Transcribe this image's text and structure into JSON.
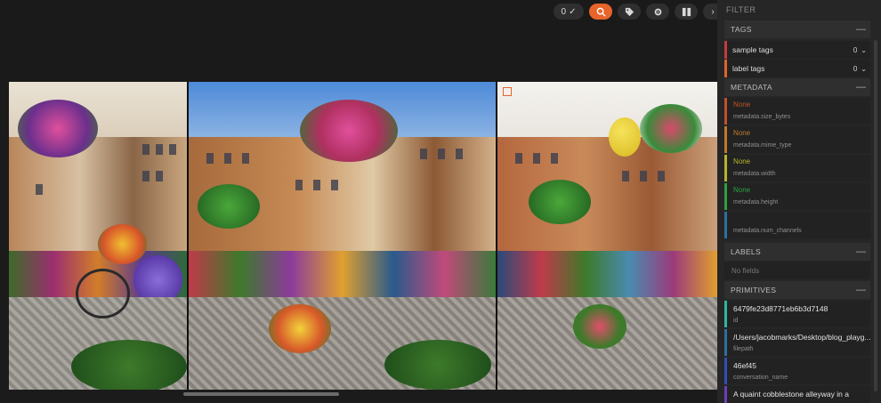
{
  "toolbar": {
    "selection_count": "0",
    "buttons": [
      "selection-check",
      "search",
      "tag",
      "settings",
      "layout",
      "next"
    ]
  },
  "sidebar": {
    "filter_title": "FILTER",
    "tags": {
      "title": "TAGS",
      "items": [
        {
          "label": "sample tags",
          "count": "0",
          "color": "#c33b3b"
        },
        {
          "label": "label tags",
          "count": "0",
          "color": "#e0642a"
        }
      ]
    },
    "metadata": {
      "title": "METADATA",
      "items": [
        {
          "value": "None",
          "key": "metadata.size_bytes",
          "color": "#c0522a"
        },
        {
          "value": "None",
          "key": "metadata.mime_type",
          "color": "#c07a2a"
        },
        {
          "value": "None",
          "key": "metadata.width",
          "color": "#b7b52a"
        },
        {
          "value": "None",
          "key": "metadata.height",
          "color": "#2ea043"
        },
        {
          "value": "",
          "key": "metadata.num_channels",
          "color": "#2e6fa0"
        }
      ]
    },
    "labels": {
      "title": "LABELS",
      "empty_text": "No fields"
    },
    "primitives": {
      "title": "PRIMITIVES",
      "items": [
        {
          "value": "6479fe23d8771eb6b3d7148",
          "key": "id",
          "color": "#2fb6a0"
        },
        {
          "value": "/Users/jacobmarks/Desktop/blog_playg...",
          "key": "filepath",
          "color": "#2e6fa0"
        },
        {
          "value": "46ef45",
          "key": "conversation_name",
          "color": "#2f4fb6"
        },
        {
          "value": "A quaint cobblestone alleyway in a",
          "key": "",
          "color": "#6a3fb6"
        }
      ]
    }
  },
  "grid": {
    "images": [
      {
        "name": "flower-basket-street-1"
      },
      {
        "name": "flower-basket-street-2"
      },
      {
        "name": "flower-basket-street-3"
      }
    ]
  }
}
